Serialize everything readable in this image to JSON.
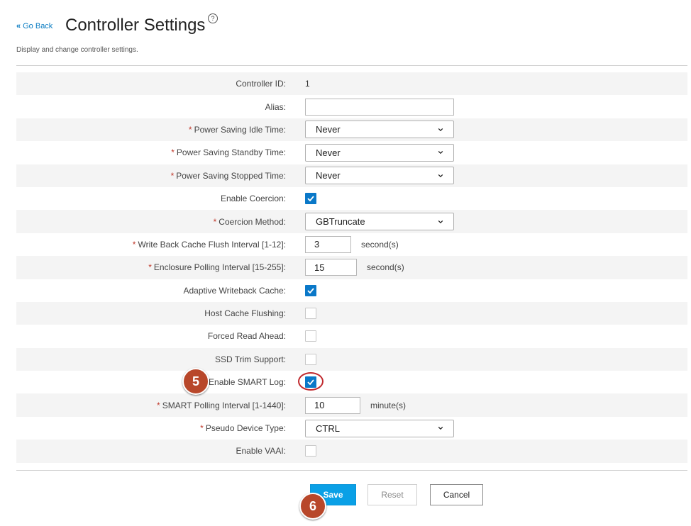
{
  "header": {
    "back_label": "Go Back",
    "title": "Controller Settings",
    "help_icon": "?",
    "subtitle": "Display and change controller settings."
  },
  "fields": [
    {
      "label": "Controller ID:",
      "required": false,
      "type": "text",
      "value": "1"
    },
    {
      "label": "Alias:",
      "required": false,
      "type": "input",
      "value": "",
      "width": 210
    },
    {
      "label": "Power Saving Idle Time:",
      "required": true,
      "type": "select",
      "value": "Never"
    },
    {
      "label": "Power Saving Standby Time:",
      "required": true,
      "type": "select",
      "value": "Never"
    },
    {
      "label": "Power Saving Stopped Time:",
      "required": true,
      "type": "select",
      "value": "Never"
    },
    {
      "label": "Enable Coercion:",
      "required": false,
      "type": "checkbox",
      "checked": true
    },
    {
      "label": "Coercion Method:",
      "required": true,
      "type": "select",
      "value": "GBTruncate"
    },
    {
      "label": "Write Back Cache Flush Interval [1-12]:",
      "required": true,
      "type": "input",
      "value": "3",
      "width": 65,
      "unit": "second(s)"
    },
    {
      "label": "Enclosure Polling Interval [15-255]:",
      "required": true,
      "type": "input",
      "value": "15",
      "width": 73,
      "unit": "second(s)"
    },
    {
      "label": "Adaptive Writeback Cache:",
      "required": false,
      "type": "checkbox",
      "checked": true
    },
    {
      "label": "Host Cache Flushing:",
      "required": false,
      "type": "checkbox",
      "checked": false
    },
    {
      "label": "Forced Read Ahead:",
      "required": false,
      "type": "checkbox",
      "checked": false
    },
    {
      "label": "SSD Trim Support:",
      "required": false,
      "type": "checkbox",
      "checked": false
    },
    {
      "label": "Enable SMART Log:",
      "required": false,
      "type": "checkbox",
      "checked": true,
      "highlight": true
    },
    {
      "label": "SMART Polling Interval [1-1440]:",
      "required": true,
      "type": "input",
      "value": "10",
      "width": 78,
      "unit": "minute(s)"
    },
    {
      "label": "Pseudo Device Type:",
      "required": true,
      "type": "select",
      "value": "CTRL"
    },
    {
      "label": "Enable VAAI:",
      "required": false,
      "type": "checkbox",
      "checked": false
    }
  ],
  "buttons": {
    "save": "Save",
    "reset": "Reset",
    "cancel": "Cancel"
  },
  "callouts": {
    "step5": "5",
    "step6": "6"
  },
  "colors": {
    "accent": "#0a78c8",
    "save_button": "#0aa0e6",
    "callout": "#b8472a",
    "highlight_ring": "#c0282d",
    "required_star": "#c0392b"
  }
}
